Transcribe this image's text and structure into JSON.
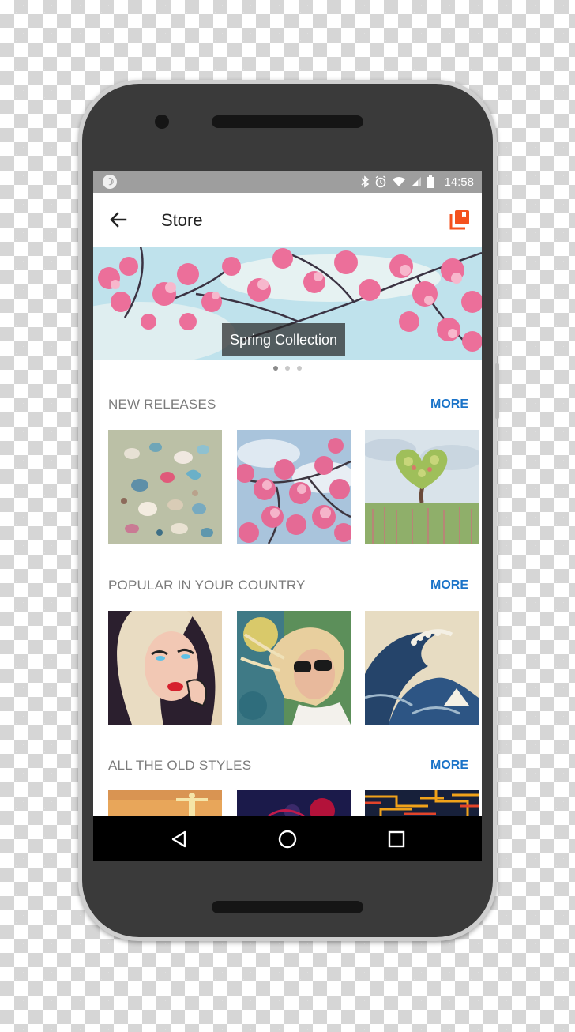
{
  "status_bar": {
    "time": "14:58",
    "left_icon": "☽",
    "icons": [
      "bluetooth-icon",
      "alarm-icon",
      "wifi-icon",
      "signal-icon",
      "battery-icon"
    ]
  },
  "app_bar": {
    "title": "Store",
    "back_icon": "arrow-back-icon",
    "action_icon": "library-icon",
    "accent_color": "#f4511e"
  },
  "banner": {
    "caption": "Spring Collection",
    "pages": 3,
    "active_page": 1
  },
  "sections": [
    {
      "title": "NEW RELEASES",
      "more_label": "MORE",
      "tiles": [
        "seashells-style",
        "cherry-blossom-style",
        "heart-tree-style"
      ]
    },
    {
      "title": "POPULAR IN YOUR COUNTRY",
      "more_label": "MORE",
      "tiles": [
        "pop-art-woman-style",
        "sunglasses-woman-style",
        "great-wave-style"
      ]
    },
    {
      "title": "ALL THE OLD STYLES",
      "more_label": "MORE",
      "tiles": [
        "statue-style",
        "dark-flower-style",
        "circuit-style"
      ]
    }
  ],
  "nav_bar": {
    "buttons": [
      "back-triangle-icon",
      "home-circle-icon",
      "recents-square-icon"
    ]
  },
  "colors": {
    "link": "#1a73c8",
    "section_title": "#7b7b7b",
    "status_bar": "#9e9e9e"
  }
}
